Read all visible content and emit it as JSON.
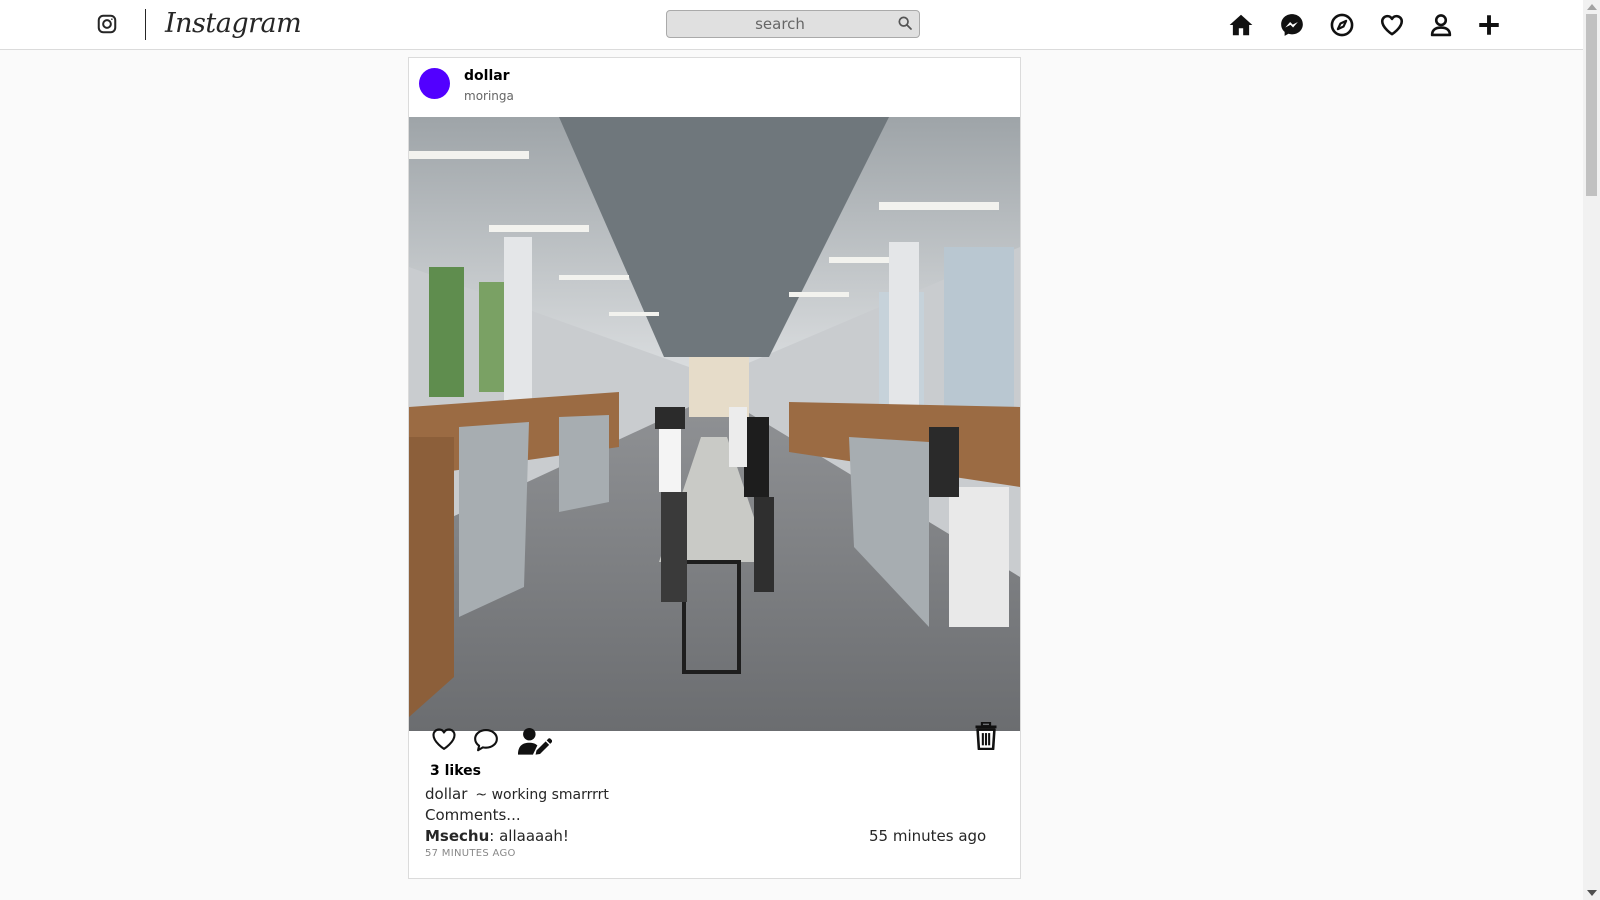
{
  "header": {
    "brand": "Instagram",
    "search_placeholder": "search",
    "icons": [
      "instagram-icon",
      "search-icon",
      "home-icon",
      "messenger-icon",
      "explore-icon",
      "heart-icon",
      "profile-icon",
      "plus-icon"
    ]
  },
  "post": {
    "username": "dollar",
    "location": "moringa",
    "likes": "3 likes",
    "caption_user": "dollar",
    "caption_text": "~ working smarrrrt",
    "comments_link": "Comments...",
    "comment_user": "Msechu",
    "comment_text": ": allaaaah!",
    "comment_time": "55 minutes ago",
    "post_time": "57 MINUTES AGO",
    "avatar_color": "#5200ff",
    "icons": [
      "heart-outline-icon",
      "comment-icon",
      "user-edit-icon",
      "trash-icon"
    ]
  }
}
